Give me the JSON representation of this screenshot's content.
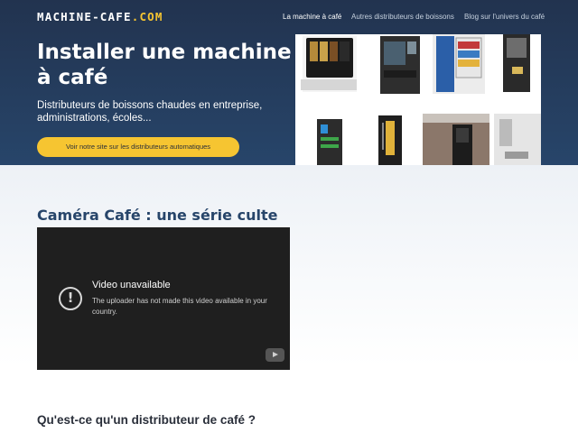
{
  "header": {
    "logo_main": "MACHINE-CAFE",
    "logo_tld": ".COM",
    "nav": [
      {
        "label": "La machine à café",
        "active": true
      },
      {
        "label": "Autres distributeurs de boissons",
        "active": false
      },
      {
        "label": "Blog sur l'univers du café",
        "active": false
      }
    ]
  },
  "hero": {
    "title": "Installer une machine à café",
    "subtitle": "Distributeurs de boissons chaudes en entreprise, administrations, écoles...",
    "cta_label": "Voir notre site sur les distributeurs automatiques"
  },
  "section": {
    "title": "Caméra Café : une série culte"
  },
  "video": {
    "title": "Video unavailable",
    "message": "The uploader has not made this video available in your country."
  },
  "next_section": {
    "title": "Qu'est-ce qu'un distributeur de café ?"
  },
  "colors": {
    "hero_dark": "#22334f",
    "hero_light": "#27456a",
    "accent_yellow": "#f6c531",
    "video_bg": "#1f1f1f"
  }
}
